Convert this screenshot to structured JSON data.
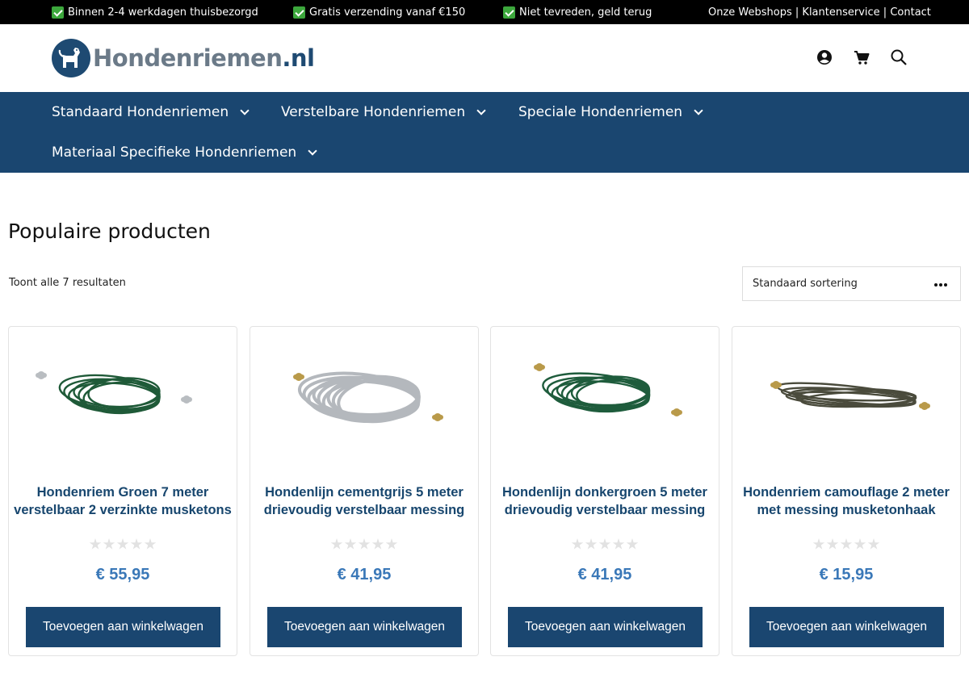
{
  "topbar": {
    "usps": [
      "Binnen 2-4 werkdagen thuisbezorgd",
      "Gratis verzending vanaf €150",
      "Niet tevreden, geld terug"
    ],
    "links": [
      "Onze Webshops",
      "Klantenservice",
      "Contact"
    ],
    "separator": " | "
  },
  "header": {
    "logo_main": "Hondenriemen",
    "logo_tld": ".nl",
    "icons": [
      "account-icon",
      "cart-icon",
      "search-icon"
    ]
  },
  "nav": {
    "items": [
      {
        "label": "Standaard Hondenriemen"
      },
      {
        "label": "Verstelbare Hondenriemen"
      },
      {
        "label": "Speciale Hondenriemen"
      },
      {
        "label": "Materiaal Specifieke Hondenriemen"
      }
    ]
  },
  "main": {
    "title": "Populaire producten",
    "result_count": "Toont alle 7 resultaten",
    "sort_selected": "Standaard sortering"
  },
  "products": [
    {
      "title": "Hondenriem Groen 7 meter verstelbaar 2 verzinkte musketons",
      "rating": 0,
      "price": "€ 55,95",
      "button": "Toevoegen aan winkelwagen",
      "leash_color": "#1f5a38",
      "hook_color": "#b9bdc1"
    },
    {
      "title": "Hondenlijn cementgrijs 5 meter drievoudig verstelbaar messing",
      "rating": 0,
      "price": "€ 41,95",
      "button": "Toevoegen aan winkelwagen",
      "leash_color": "#b4b8bd",
      "hook_color": "#b99a4a"
    },
    {
      "title": "Hondenlijn donkergroen 5 meter drievoudig verstelbaar messing",
      "rating": 0,
      "price": "€ 41,95",
      "button": "Toevoegen aan winkelwagen",
      "leash_color": "#1e5c3c",
      "hook_color": "#b99a4a"
    },
    {
      "title": "Hondenriem camouflage 2 meter met messing musketonhaak",
      "rating": 0,
      "price": "€ 15,95",
      "button": "Toevoegen aan winkelwagen",
      "leash_color": "#4a4b3c",
      "hook_color": "#b99a4a"
    }
  ],
  "colors": {
    "nav_bg": "#1a4670",
    "title_blue": "#17466e",
    "price_blue": "#3a78b8",
    "usp_check": "#3ca73c"
  }
}
